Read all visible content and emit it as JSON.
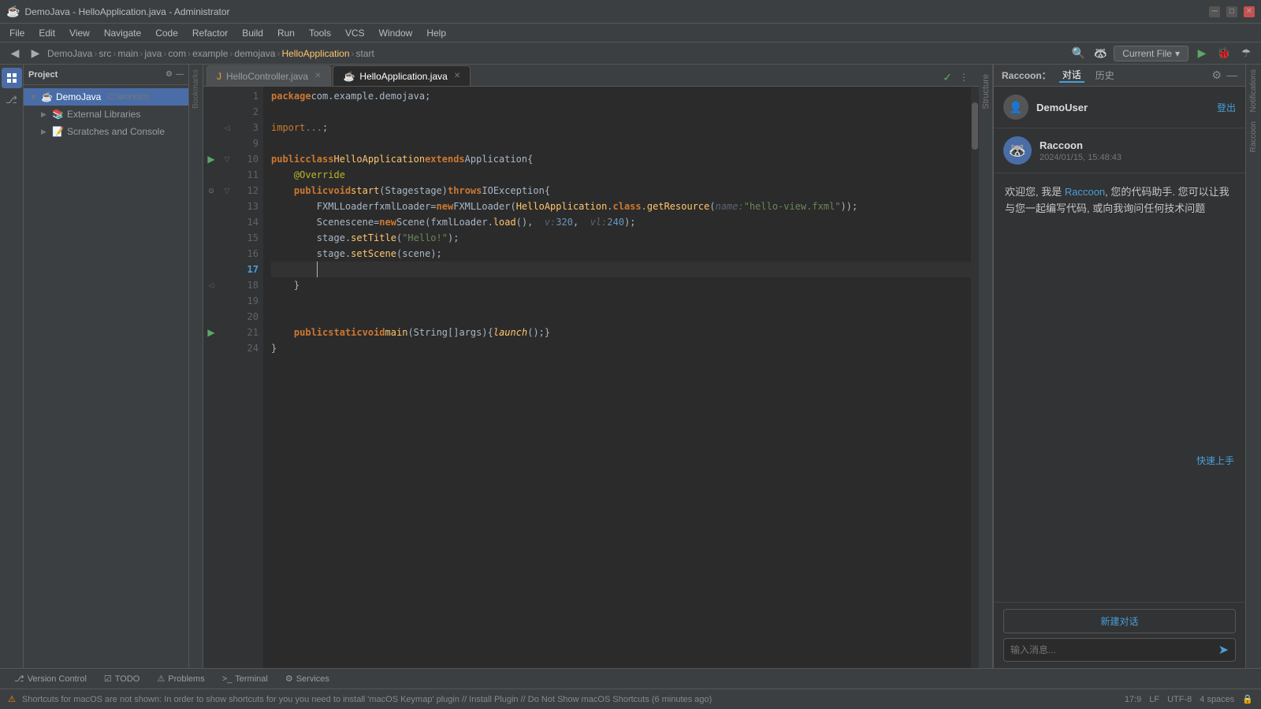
{
  "window": {
    "title": "DemoJava - HelloApplication.java - Administrator",
    "app_name": "DemoJava"
  },
  "menu": {
    "items": [
      "File",
      "Edit",
      "View",
      "Navigate",
      "Code",
      "Refactor",
      "Build",
      "Run",
      "Tools",
      "VCS",
      "Window",
      "Help"
    ]
  },
  "breadcrumb": {
    "parts": [
      "src",
      "main",
      "java",
      "com",
      "example",
      "demojava",
      "HelloApplication",
      "start"
    ]
  },
  "toolbar": {
    "current_file_label": "Current File",
    "run_label": "▶",
    "debug_label": "🐞"
  },
  "project_panel": {
    "title": "Project",
    "items": [
      {
        "label": "DemoJava",
        "path": "C:\\work\\tm",
        "indent": 0,
        "type": "project",
        "expanded": true
      },
      {
        "label": "External Libraries",
        "indent": 1,
        "type": "library",
        "expanded": false
      },
      {
        "label": "Scratches and Console",
        "indent": 1,
        "type": "scratches",
        "expanded": false
      }
    ]
  },
  "editor": {
    "tabs": [
      {
        "label": "HelloController.java",
        "active": false,
        "modified": false,
        "icon": "java"
      },
      {
        "label": "HelloApplication.java",
        "active": true,
        "modified": false,
        "icon": "java"
      }
    ],
    "lines": [
      {
        "num": 1,
        "code": "package com.example.demojava;"
      },
      {
        "num": 2,
        "code": ""
      },
      {
        "num": 3,
        "code": "import ...;"
      },
      {
        "num": 9,
        "code": ""
      },
      {
        "num": 10,
        "code": "public class HelloApplication extends Application {"
      },
      {
        "num": 11,
        "code": "    @Override"
      },
      {
        "num": 12,
        "code": "    public void start(Stage stage) throws IOException {"
      },
      {
        "num": 13,
        "code": "        FXMLLoader fxmlLoader = new FXMLLoader(HelloApplication.class.getResource( name: \"hello-view.fxml\"));"
      },
      {
        "num": 14,
        "code": "        Scene scene = new Scene(fxmlLoader.load(),  v: 320,  vl: 240);"
      },
      {
        "num": 15,
        "code": "        stage.setTitle(\"Hello!\");"
      },
      {
        "num": 16,
        "code": "        stage.setScene(scene);"
      },
      {
        "num": 17,
        "code": "        |"
      },
      {
        "num": 18,
        "code": "    }"
      },
      {
        "num": 19,
        "code": ""
      },
      {
        "num": 20,
        "code": ""
      },
      {
        "num": 21,
        "code": "    public static void main(String[] args) { launch(); }"
      },
      {
        "num": 24,
        "code": "}"
      }
    ]
  },
  "raccoon": {
    "title": "Raccoon：",
    "tabs": [
      "对话",
      "历史"
    ],
    "user": {
      "avatar": "👤",
      "name": "DemoUser",
      "logout_label": "登出"
    },
    "bot": {
      "avatar": "🦝",
      "name": "Raccoon",
      "timestamp": "2024/01/15, 15:48:43"
    },
    "greeting": "欢迎您, 我是 Raccoon, 您的代码助手. 您可以让我与您一起编写代码, 或向我询问任何技术问题",
    "highlight_word": "Raccoon",
    "new_chat_label": "新建对话",
    "input_placeholder": "输入消息...",
    "quick_start_label": "快速上手"
  },
  "status_bar": {
    "warning_text": "Shortcuts for macOS are not shown: In order to show shortcuts for you you need to install 'macOS Keymap' plugin // Install Plugin // Do Not Show macOS Shortcuts (6 minutes ago)",
    "position": "17:9",
    "encoding": "UTF-8",
    "indent": "4 spaces",
    "line_ending": "LF"
  },
  "bottom_tabs": [
    {
      "label": "Version Control",
      "icon": "⎇",
      "active": false
    },
    {
      "label": "TODO",
      "icon": "☑",
      "active": false
    },
    {
      "label": "Problems",
      "icon": "⚠",
      "active": false
    },
    {
      "label": "Terminal",
      "icon": ">_",
      "active": false
    },
    {
      "label": "Services",
      "icon": "⚙",
      "active": false
    }
  ]
}
